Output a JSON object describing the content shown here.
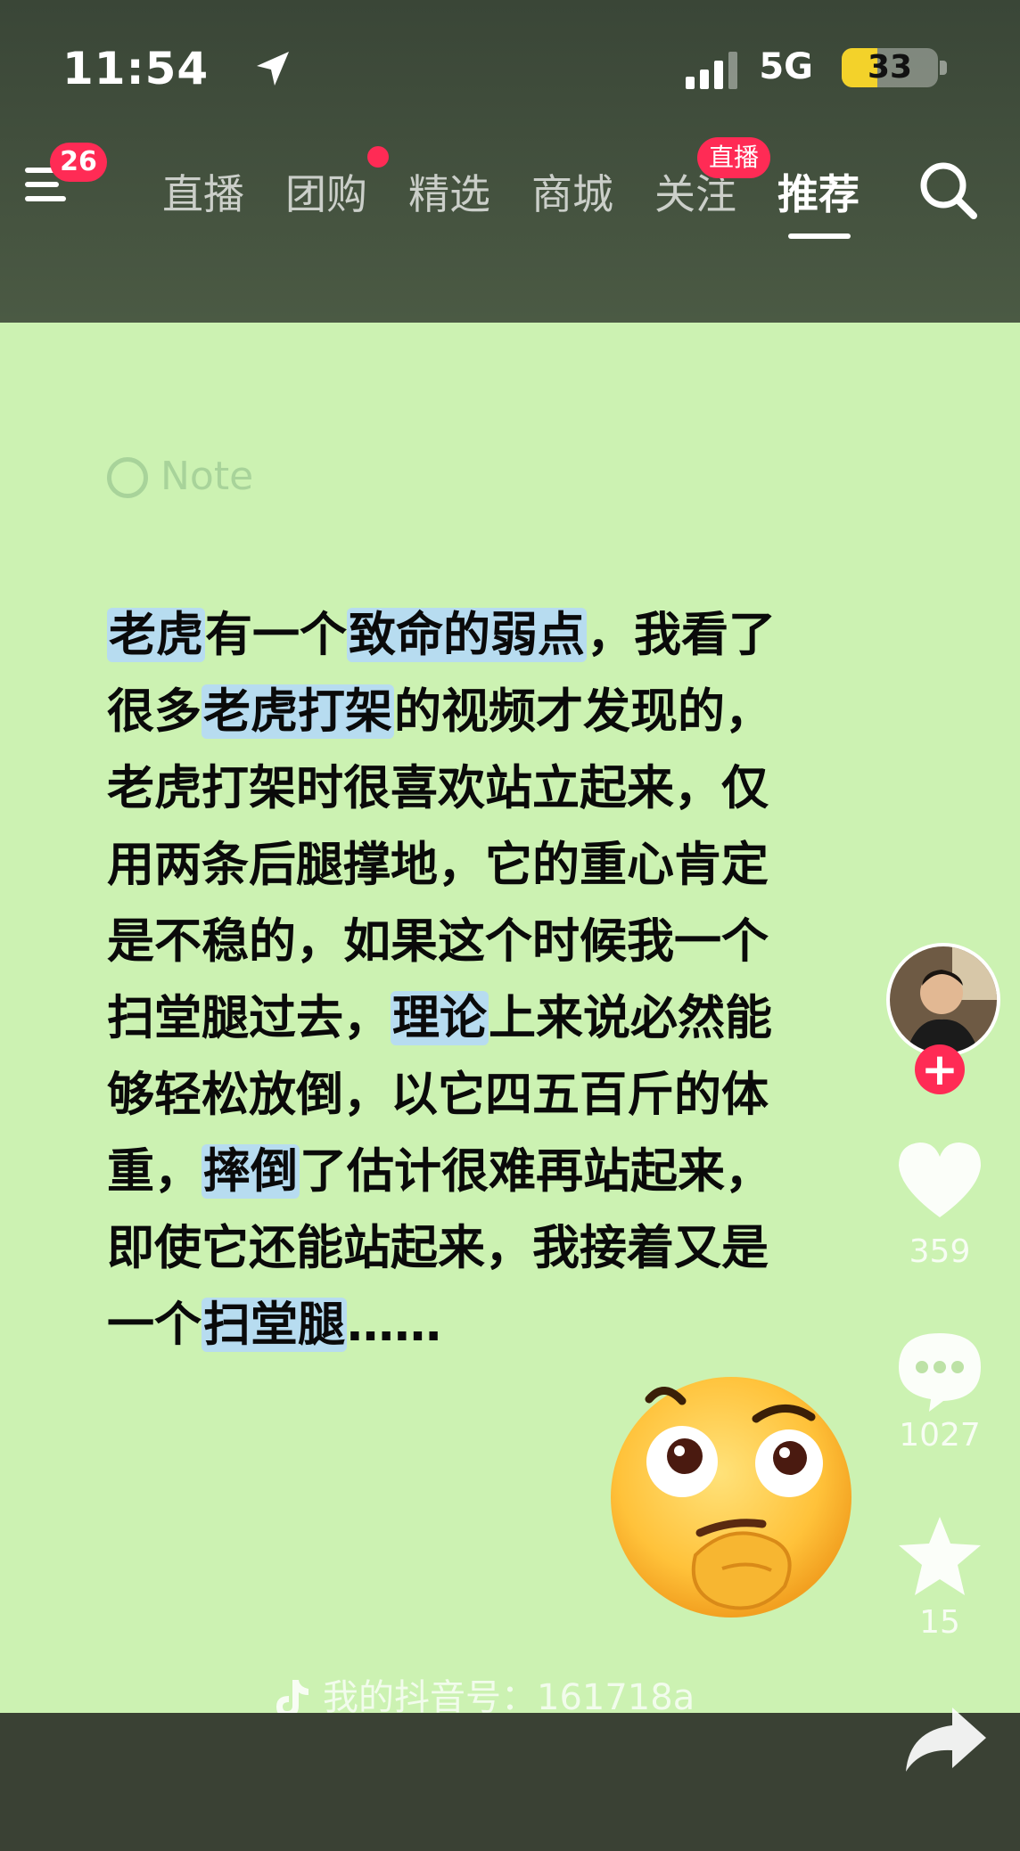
{
  "status_bar": {
    "time": "11:54",
    "network": "5G",
    "battery": "33"
  },
  "nav": {
    "menu_badge": "26",
    "tabs": [
      {
        "label": "直播"
      },
      {
        "label": "团购"
      },
      {
        "label": "精选"
      },
      {
        "label": "商城"
      },
      {
        "label": "关注"
      },
      {
        "label": "推荐"
      }
    ],
    "live_badge": "直播",
    "active_tab": "推荐"
  },
  "note": {
    "tag": "Note"
  },
  "post": {
    "lines": [
      [
        {
          "t": "老虎",
          "hl": true
        },
        {
          "t": "有一个"
        },
        {
          "t": "致命的弱点",
          "hl": true
        },
        {
          "t": "，我看了"
        }
      ],
      [
        {
          "t": "很多"
        },
        {
          "t": "老虎打架",
          "hl": true
        },
        {
          "t": "的视频才发现的，"
        }
      ],
      [
        {
          "t": "老虎打架时很喜欢站立起来，仅"
        }
      ],
      [
        {
          "t": "用两条后腿撑地，它的重心肯定"
        }
      ],
      [
        {
          "t": "是不稳的，如果这个时候我一个"
        }
      ],
      [
        {
          "t": "扫堂腿过去，"
        },
        {
          "t": "理论",
          "hl": true
        },
        {
          "t": "上来说必然能"
        }
      ],
      [
        {
          "t": "够轻松放倒，以它四五百斤的体"
        }
      ],
      [
        {
          "t": "重，"
        },
        {
          "t": "摔倒",
          "hl": true
        },
        {
          "t": "了估计很难再站起来，"
        }
      ],
      [
        {
          "t": "即使它还能站起来，我接着又是"
        }
      ],
      [
        {
          "t": "一个"
        },
        {
          "t": "扫堂腿",
          "hl": true
        },
        {
          "t": "……"
        }
      ]
    ]
  },
  "watermark": "我的抖音号：161718a",
  "sidebar": {
    "likes": "359",
    "comments": "1027",
    "favorites": "15"
  },
  "colors": {
    "card_bg": "#ccf2b2",
    "highlight": "#b7dcf0",
    "accent": "#ff2b55"
  }
}
